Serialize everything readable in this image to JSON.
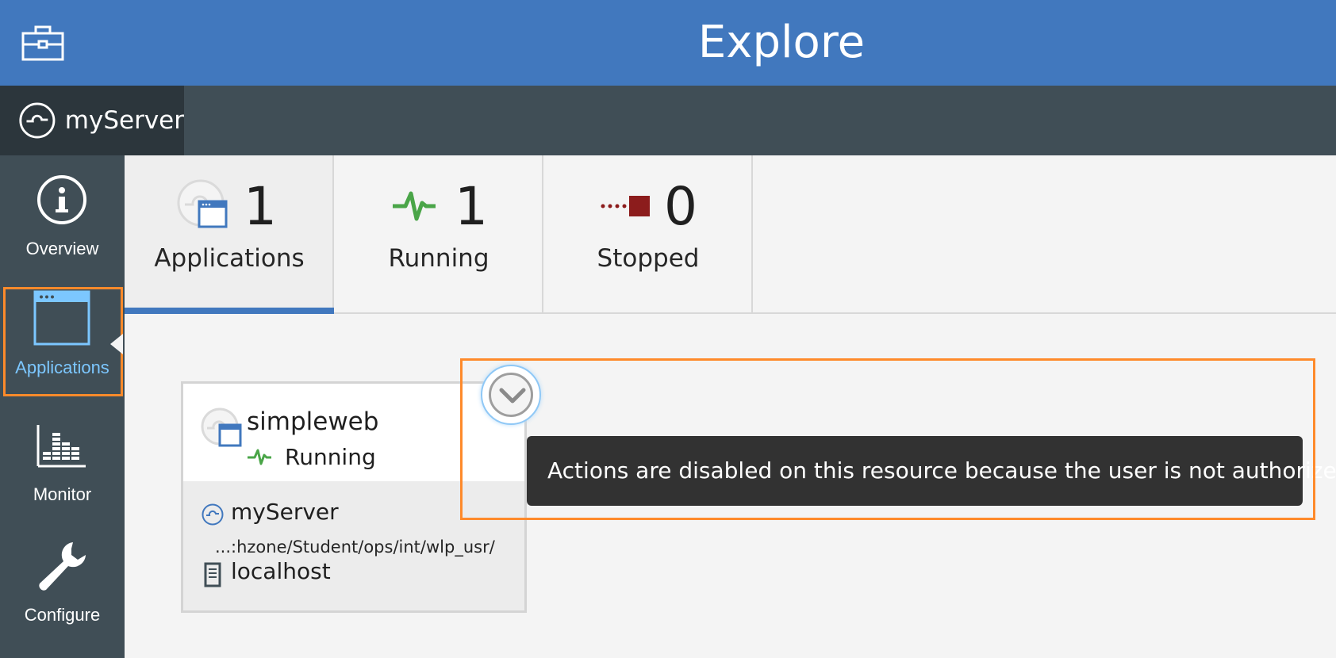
{
  "header": {
    "title": "Explore",
    "icon": "toolbox-icon",
    "background_color": "#4178be"
  },
  "server_bar": {
    "server_name": "myServer",
    "icon": "server-icon"
  },
  "nav": {
    "items": [
      {
        "label": "Overview",
        "icon": "info-icon",
        "active": false
      },
      {
        "label": "Applications",
        "icon": "application-window-icon",
        "active": true
      },
      {
        "label": "Monitor",
        "icon": "monitor-chart-icon",
        "active": false
      },
      {
        "label": "Configure",
        "icon": "wrench-icon",
        "active": false
      }
    ],
    "active_color": "#7cc7ff",
    "highlight_color": "#fe8a2b"
  },
  "summary": {
    "tiles": [
      {
        "count": "1",
        "label": "Applications",
        "icon": "application-icon",
        "selected": true
      },
      {
        "count": "1",
        "label": "Running",
        "icon": "running-pulse-icon",
        "selected": false
      },
      {
        "count": "0",
        "label": "Stopped",
        "icon": "stopped-square-icon",
        "selected": false
      }
    ]
  },
  "app_card": {
    "name": "simpleweb",
    "status": "Running",
    "server": "myServer",
    "path": "...:hzone/Student/ops/int/wlp_usr/",
    "host": "localhost"
  },
  "tooltip": {
    "text": "Actions are disabled on this resource because the user is not authorized"
  },
  "colors": {
    "running": "#4aa548",
    "stopped": "#8c1c1c",
    "tooltip_bg": "#323232"
  }
}
